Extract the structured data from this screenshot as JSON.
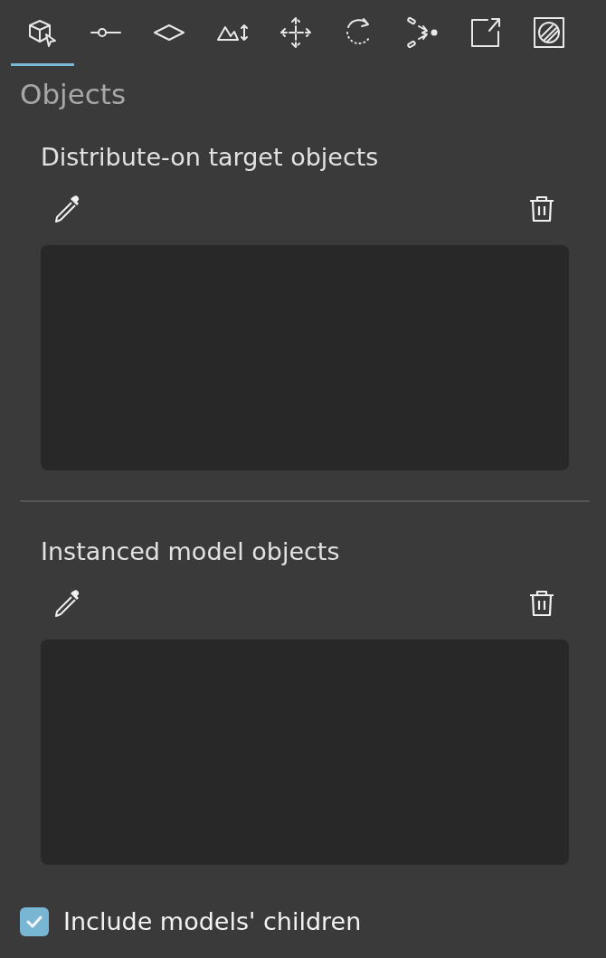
{
  "toolbar": {
    "tabs": [
      {
        "selected": true
      },
      {
        "selected": false
      },
      {
        "selected": false
      },
      {
        "selected": false
      },
      {
        "selected": false
      },
      {
        "selected": false
      },
      {
        "selected": false
      },
      {
        "selected": false
      },
      {
        "selected": false
      }
    ]
  },
  "panel": {
    "title": "Objects",
    "sections": [
      {
        "title": "Distribute-on target objects"
      },
      {
        "title": "Instanced model objects"
      }
    ]
  },
  "include_children": {
    "label": "Include models' children",
    "checked": true
  }
}
